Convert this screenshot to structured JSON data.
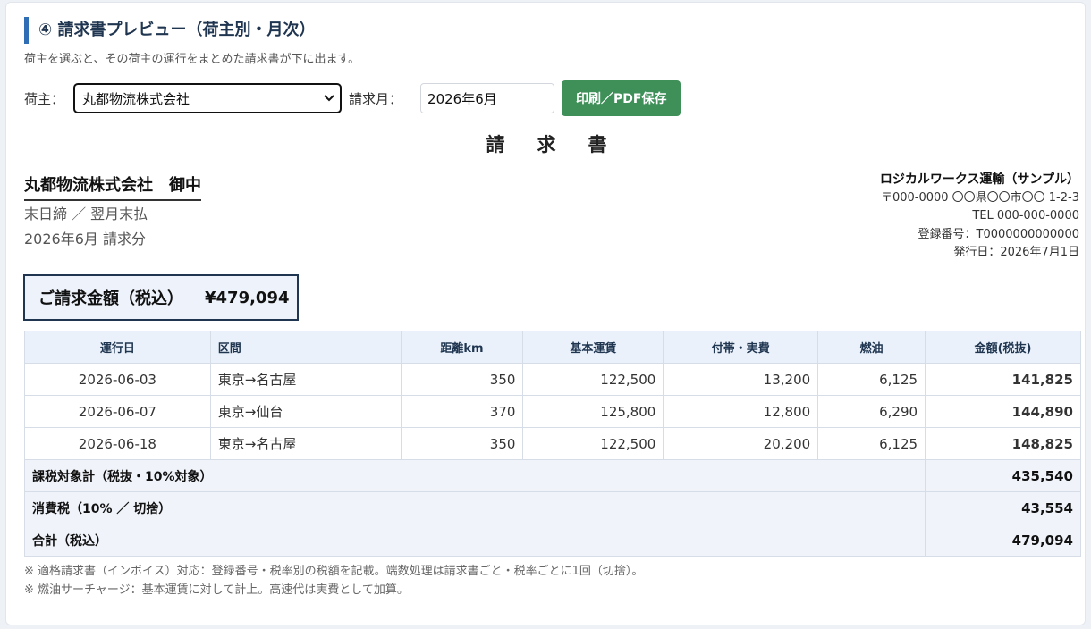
{
  "section": {
    "title": "④ 請求書プレビュー（荷主別・月次）",
    "description": "荷主を選ぶと、その荷主の運行をまとめた請求書が下に出ます。"
  },
  "controls": {
    "shipper_label": "荷主：",
    "shipper_selected": "丸都物流株式会社",
    "month_label": "請求月：",
    "month_value": "2026年6月",
    "print_label": "印刷／PDF保存"
  },
  "invoice": {
    "title": "請求書",
    "recipient_name": "丸都物流株式会社　御中",
    "terms": "末日締 ／ 翌月末払",
    "period": "2026年6月 請求分",
    "issuer": {
      "company": "ロジカルワークス運輸（サンプル）",
      "address": "〒000-0000 〇〇県〇〇市〇〇 1-2-3",
      "tel": "TEL 000-000-0000",
      "registration": "登録番号：T0000000000000",
      "issue_date": "発行日：2026年7月1日"
    },
    "total_label": "ご請求金額（税込）",
    "total_amount": "¥479,094"
  },
  "table": {
    "headers": [
      "運行日",
      "区間",
      "距離km",
      "基本運賃",
      "付帯・実費",
      "燃油",
      "金額(税抜)"
    ],
    "rows": [
      [
        "2026-06-03",
        "東京→名古屋",
        "350",
        "122,500",
        "13,200",
        "6,125",
        "141,825"
      ],
      [
        "2026-06-07",
        "東京→仙台",
        "370",
        "125,800",
        "12,800",
        "6,290",
        "144,890"
      ],
      [
        "2026-06-18",
        "東京→名古屋",
        "350",
        "122,500",
        "20,200",
        "6,125",
        "148,825"
      ]
    ],
    "summary": [
      {
        "label": "課税対象計（税抜・10%対象）",
        "value": "435,540"
      },
      {
        "label": "消費税（10% ／ 切捨）",
        "value": "43,554"
      },
      {
        "label": "合計（税込）",
        "value": "479,094"
      }
    ]
  },
  "notes": [
    "※ 適格請求書（インボイス）対応：登録番号・税率別の税額を記載。端数処理は請求書ごと・税率ごとに1回（切捨）。",
    "※ 燃油サーチャージ：基本運賃に対して計上。高速代は実費として加算。"
  ]
}
